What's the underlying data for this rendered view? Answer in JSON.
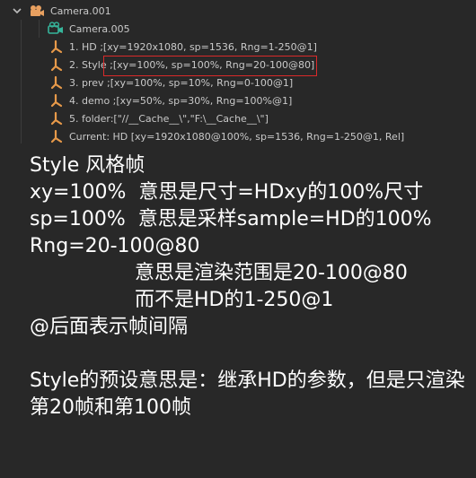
{
  "outliner": {
    "camera_label": "Camera.001",
    "camera_data_label": "Camera.005",
    "markers": [
      {
        "label": "1. HD   ;[xy=1920x1080, sp=1536, Rng=1-250@1]"
      },
      {
        "label": "2. Style ;[xy=100%, sp=100%, Rng=20-100@80]"
      },
      {
        "label": "3. prev  ;[xy=100%, sp=10%, Rng=0-100@1]"
      },
      {
        "label": "4. demo  ;[xy=50%, sp=30%, Rng=100%@1]"
      },
      {
        "label": "5. folder:[\"//__Cache__\\\",\"F:\\__Cache__\\\"]"
      },
      {
        "label": "Current: HD [xy=1920x1080@100%, sp=1536, Rng=1-250@1, Rel]"
      }
    ],
    "colors": {
      "marker_icon": "#e89a4a",
      "camera_icon": "#e8a060",
      "camera_data_icon": "#36b59b",
      "highlight": "#d92a2a"
    }
  },
  "notes": {
    "line1": "Style 风格帧",
    "line2": "xy=100%  意思是尺寸=HDxy的100%尺寸",
    "line3": "sp=100%  意思是采样sample=HD的100%",
    "line4": "Rng=20-100@80",
    "line5": "意思是渲染范围是20-100@80",
    "line6": "而不是HD的1-250@1",
    "line7": "@后面表示帧间隔",
    "line8": "Style的预设意思是：继承HD的参数，但是只渲染第20帧和第100帧"
  }
}
